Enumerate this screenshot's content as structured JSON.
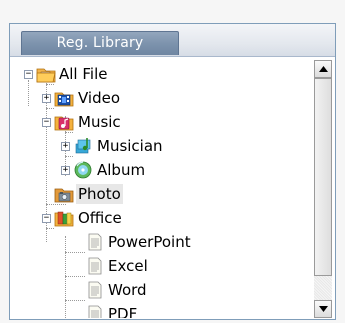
{
  "panel": {
    "tab_label": "Reg. Library"
  },
  "tree": {
    "items": [
      {
        "label": "All File",
        "icon": "folder-gallery-icon",
        "expander": "minus"
      },
      {
        "label": "Video",
        "icon": "video-folder-icon",
        "expander": "plus"
      },
      {
        "label": "Music",
        "icon": "music-folder-icon",
        "expander": "minus"
      },
      {
        "label": "Musician",
        "icon": "musician-icon",
        "expander": "plus"
      },
      {
        "label": "Album",
        "icon": "album-disc-icon",
        "expander": "plus"
      },
      {
        "label": "Photo",
        "icon": "photo-folder-icon",
        "expander": "",
        "selected": true
      },
      {
        "label": "Office",
        "icon": "office-folder-icon",
        "expander": "minus"
      },
      {
        "label": "PowerPoint",
        "icon": "document-icon",
        "expander": ""
      },
      {
        "label": "Excel",
        "icon": "document-icon",
        "expander": ""
      },
      {
        "label": "Word",
        "icon": "document-icon",
        "expander": ""
      },
      {
        "label": "PDF",
        "icon": "document-icon",
        "expander": ""
      }
    ]
  },
  "colors": {
    "border": "#7f9db9",
    "tab": "#7d93ad",
    "selected_bg": "#e7e7e7"
  }
}
